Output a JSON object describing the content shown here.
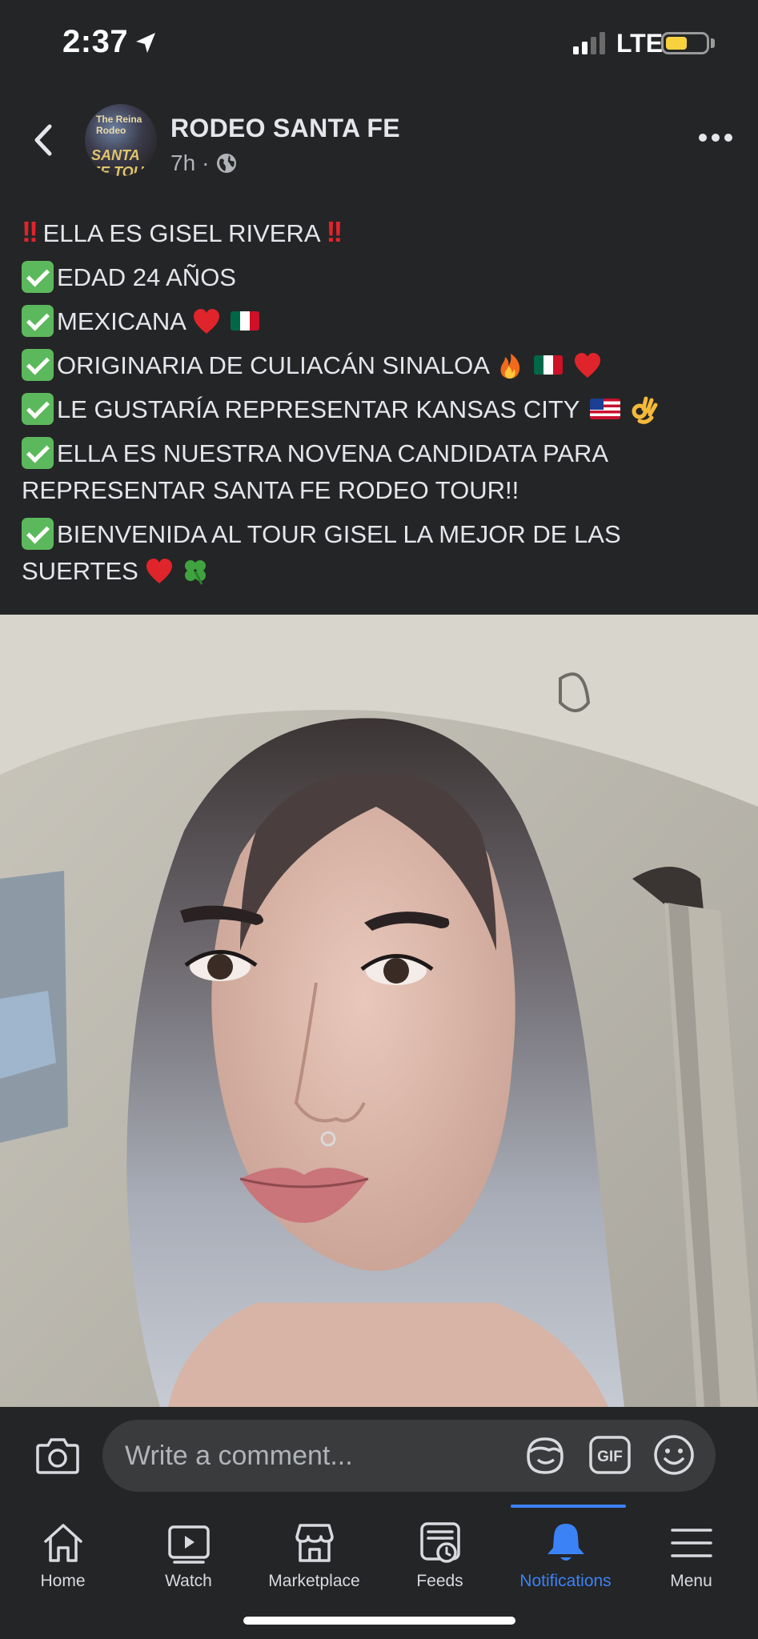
{
  "status_bar": {
    "time": "2:37",
    "network": "LTE",
    "battery_level": 0.55,
    "colors": {
      "battery": "#f7d23e"
    }
  },
  "post": {
    "page_name": "RODEO SANTA FE",
    "avatar_text_top": "The Reina Rodeo",
    "avatar_text_bottom": "SANTA FE TOUR",
    "time_ago": "7h",
    "separator": "·",
    "lines": [
      "ELLA ES GISEL RIVERA",
      "EDAD 24 AÑOS",
      "MEXICANA",
      "ORIGINARIA DE CULIACÁN SINALOA",
      "LE GUSTARÍA REPRESENTAR KANSAS CITY",
      "ELLA ES NUESTRA NOVENA CANDIDATA PARA REPRESENTAR SANTA FE RODEO TOUR!!",
      "BIENVENIDA AL TOUR GISEL LA MEJOR DE LAS SUERTES"
    ],
    "emoji_marks": [
      "‼️",
      "✅",
      "❤️",
      "🇲🇽",
      "🔥",
      "🇺🇸",
      "👌",
      "🍀"
    ]
  },
  "comment_bar": {
    "placeholder": "Write a comment..."
  },
  "tabs": [
    {
      "label": "Home",
      "icon": "home-icon",
      "active": false
    },
    {
      "label": "Watch",
      "icon": "watch-icon",
      "active": false
    },
    {
      "label": "Marketplace",
      "icon": "marketplace-icon",
      "active": false
    },
    {
      "label": "Feeds",
      "icon": "feeds-icon",
      "active": false
    },
    {
      "label": "Notifications",
      "icon": "bell-icon",
      "active": true
    },
    {
      "label": "Menu",
      "icon": "menu-icon",
      "active": false
    }
  ],
  "colors": {
    "background": "#242526",
    "text": "#e4e6eb",
    "muted": "#b0b3b8",
    "accent": "#3b82f6",
    "check": "#5cb85c",
    "exclaim": "#e0242b"
  }
}
